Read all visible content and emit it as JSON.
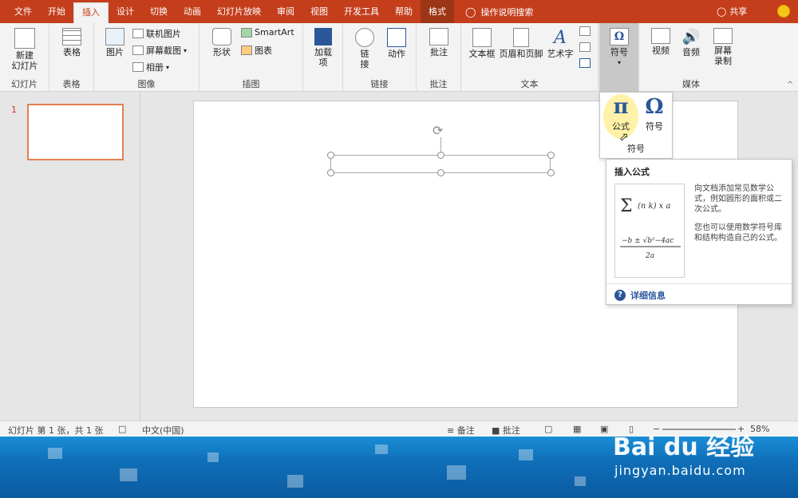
{
  "tabs": [
    {
      "label": "文件"
    },
    {
      "label": "开始"
    },
    {
      "label": "插入",
      "active": true
    },
    {
      "label": "设计"
    },
    {
      "label": "切换"
    },
    {
      "label": "动画"
    },
    {
      "label": "幻灯片放映"
    },
    {
      "label": "审阅"
    },
    {
      "label": "视图"
    },
    {
      "label": "开发工具"
    },
    {
      "label": "帮助"
    },
    {
      "label": "格式",
      "contextual": true
    }
  ],
  "tellme": "操作说明搜索",
  "share": "共享",
  "ribbon": {
    "new_slide": "新建\n幻灯片",
    "table": "表格",
    "picture": "图片",
    "online_picture": "联机图片",
    "screenshot": "屏幕截图",
    "album": "相册",
    "shapes": "形状",
    "smartart": "SmartArt",
    "chart": "图表",
    "addins": "加载\n项",
    "link": "链\n接",
    "action": "动作",
    "comment": "批注",
    "textbox": "文本框",
    "header_footer": "页眉和页脚",
    "wordart": "艺术字",
    "symbols": "符号",
    "video": "视频",
    "audio": "音频",
    "screen_record": "屏幕\n录制",
    "groups": {
      "slides": "幻灯片",
      "tables": "表格",
      "images": "图像",
      "illustrations": "插图",
      "links": "链接",
      "comments": "批注",
      "text": "文本",
      "media": "媒体"
    }
  },
  "dropdown": {
    "equation_symbol": "π",
    "equation_label": "公式",
    "symbol_symbol": "Ω",
    "symbol_label": "符号",
    "group_label": "符号"
  },
  "tooltip": {
    "title": "插入公式",
    "desc1": "向文档添加常见数学公式，例如圆形的面积或二次公式。",
    "desc2": "您也可以使用数学符号库和结构构造自己的公式。",
    "more": "详细信息"
  },
  "thumb_number": "1",
  "status": {
    "slide_info": "幻灯片 第 1 张，共 1 张",
    "language": "中文(中国)",
    "notes": "备注",
    "comments": "批注",
    "zoom": "58%"
  },
  "watermark": {
    "brand": "Bai du 经验",
    "url": "jingyan.baidu.com"
  }
}
